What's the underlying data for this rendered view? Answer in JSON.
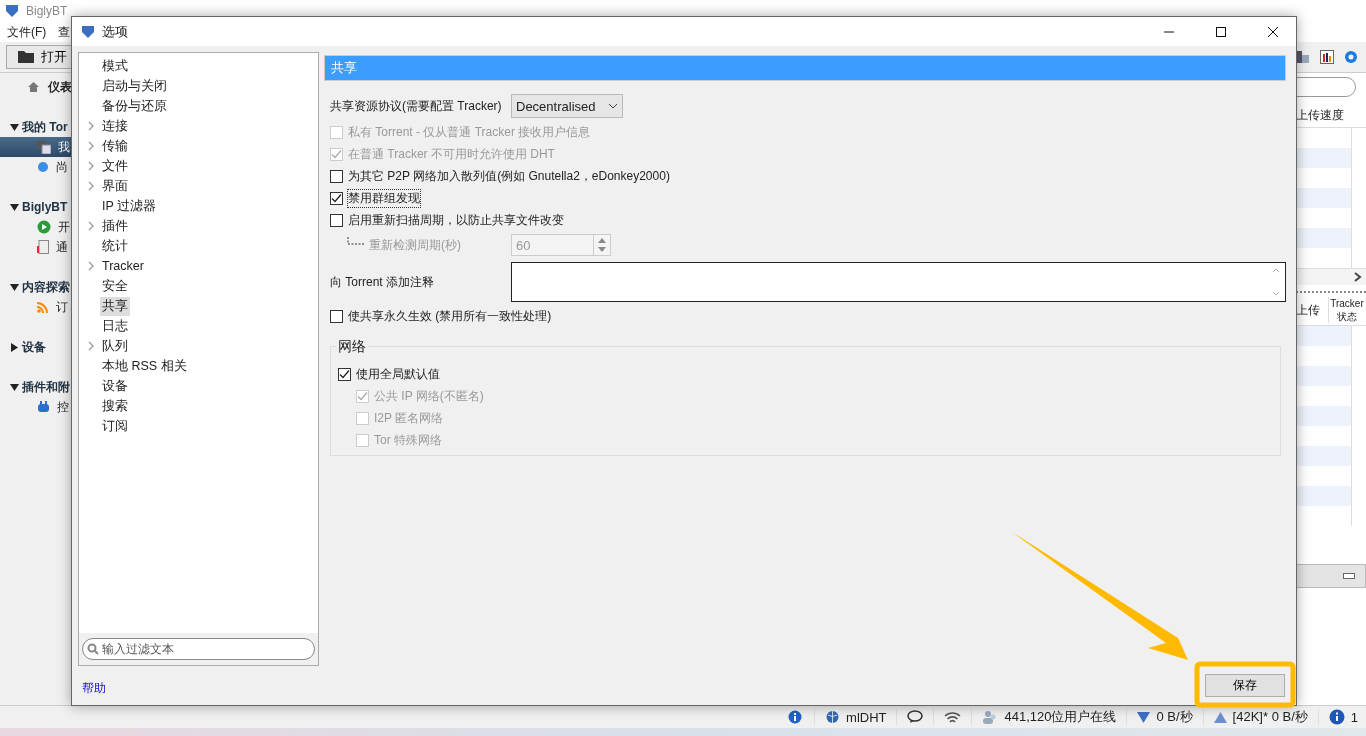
{
  "app": {
    "title": "BiglyBT",
    "menu": [
      "文件(F)",
      "查"
    ],
    "toolbar": {
      "open_button": "打开"
    },
    "sidebar": {
      "top_item": {
        "label": "仪表"
      },
      "sections": [
        {
          "label": "我的 Tor",
          "expanded": true,
          "children": [
            {
              "label": "我",
              "selected": true
            },
            {
              "label": "尚",
              "selected": false
            }
          ]
        },
        {
          "label": "BiglyBT",
          "expanded": true,
          "children": [
            {
              "label": "开",
              "selected": false
            },
            {
              "label": "通",
              "selected": false
            }
          ]
        },
        {
          "label": "内容探索",
          "expanded": true,
          "children": [
            {
              "label": "订",
              "selected": false
            }
          ]
        },
        {
          "label": "设备",
          "expanded": false
        },
        {
          "label": "插件和附",
          "expanded": true,
          "children": [
            {
              "label": "控",
              "selected": false
            }
          ]
        }
      ]
    },
    "right_panel": {
      "table_header": "上传速度",
      "lower_headers": [
        "上传",
        "Tracker 状态"
      ]
    }
  },
  "status_bar": {
    "dht": "mlDHT",
    "users": "441,120位用户在线",
    "down": "0 B/秒",
    "up": "[42K]* 0 B/秒",
    "alerts": "1"
  },
  "dialog": {
    "title": "选项",
    "tree": [
      {
        "label": "模式",
        "expandable": false,
        "selected": false
      },
      {
        "label": "启动与关闭",
        "expandable": false,
        "selected": false
      },
      {
        "label": "备份与还原",
        "expandable": false,
        "selected": false
      },
      {
        "label": "连接",
        "expandable": true,
        "selected": false
      },
      {
        "label": "传输",
        "expandable": true,
        "selected": false
      },
      {
        "label": "文件",
        "expandable": true,
        "selected": false
      },
      {
        "label": "界面",
        "expandable": true,
        "selected": false
      },
      {
        "label": "IP 过滤器",
        "expandable": false,
        "selected": false
      },
      {
        "label": "插件",
        "expandable": true,
        "selected": false
      },
      {
        "label": "统计",
        "expandable": false,
        "selected": false
      },
      {
        "label": "Tracker",
        "expandable": true,
        "selected": false
      },
      {
        "label": "安全",
        "expandable": false,
        "selected": false
      },
      {
        "label": "共享",
        "expandable": false,
        "selected": true
      },
      {
        "label": "日志",
        "expandable": false,
        "selected": false
      },
      {
        "label": "队列",
        "expandable": true,
        "selected": false
      },
      {
        "label": "本地 RSS 相关",
        "expandable": false,
        "selected": false
      },
      {
        "label": "设备",
        "expandable": false,
        "selected": false
      },
      {
        "label": "搜索",
        "expandable": false,
        "selected": false
      },
      {
        "label": "订阅",
        "expandable": false,
        "selected": false
      }
    ],
    "filter": {
      "placeholder": "输入过滤文本"
    },
    "help_link": "帮助",
    "section_title": "共享",
    "rows": [
      {
        "kind": "select",
        "label": "共享资源协议(需要配置 Tracker)",
        "value": "Decentralised"
      },
      {
        "kind": "checkbox",
        "label": "私有 Torrent - 仅从普通 Tracker 接收用户信息",
        "checked": false,
        "disabled": true,
        "focused": false
      },
      {
        "kind": "checkbox",
        "label": "在普通 Tracker 不可用时允许使用 DHT",
        "checked": true,
        "disabled": true,
        "focused": false
      },
      {
        "kind": "checkbox",
        "label": "为其它 P2P 网络加入散列值(例如 Gnutella2，eDonkey2000)",
        "checked": false,
        "disabled": false,
        "focused": false
      },
      {
        "kind": "checkbox",
        "label": "禁用群组发现",
        "checked": true,
        "disabled": false,
        "focused": true
      },
      {
        "kind": "checkbox",
        "label": "启用重新扫描周期，以防止共享文件改变",
        "checked": false,
        "disabled": false,
        "focused": false
      },
      {
        "kind": "spinner",
        "label": "重新检测周期(秒)",
        "value": "60",
        "disabled": true
      },
      {
        "kind": "textarea",
        "label": "向 Torrent 添加注释"
      },
      {
        "kind": "checkbox",
        "label": "使共享永久生效 (禁用所有一致性处理)",
        "checked": false,
        "disabled": false,
        "focused": false
      }
    ],
    "group": {
      "title": "网络",
      "items": [
        {
          "label": "使用全局默认值",
          "checked": true,
          "disabled": false,
          "children": [
            {
              "label": "公共 IP 网络(不匿名)",
              "checked": true,
              "disabled": true
            },
            {
              "label": "I2P 匿名网络",
              "checked": false,
              "disabled": true
            },
            {
              "label": "Tor 特殊网络",
              "checked": false,
              "disabled": true
            }
          ]
        }
      ]
    },
    "save_button": "保存"
  }
}
